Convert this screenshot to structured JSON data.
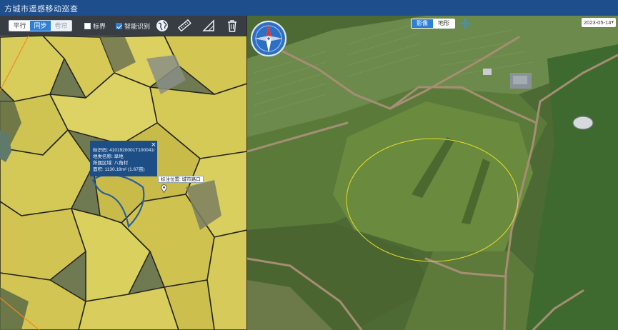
{
  "header": {
    "title": "方城市遥感移动巡查"
  },
  "toolbar": {
    "view_modes": [
      {
        "label": "平行",
        "state": "normal"
      },
      {
        "label": "同步",
        "state": "active"
      },
      {
        "label": "卷帘",
        "state": "disabled"
      }
    ],
    "checkboxes": [
      {
        "label": "标界",
        "checked": false
      },
      {
        "label": "智能识别",
        "checked": true
      }
    ],
    "tools": [
      "globe-icon",
      "ruler-icon",
      "triangle-ruler-icon",
      "trash-icon"
    ]
  },
  "popup": {
    "lines": [
      "标识码: 4101920001T1000416",
      "地类名称: 旱地",
      "所属区域: 八角村",
      "面积: 1130.18m² (1.67亩)"
    ],
    "close": "×"
  },
  "map_label": "标注位置: 城市路口",
  "right_panel": {
    "view_toggle": [
      {
        "label": "影像",
        "active": true
      },
      {
        "label": "地形",
        "active": false
      }
    ],
    "date": "2023-05-14",
    "date_caret": "▾"
  },
  "colors": {
    "header": "#1f4e8c",
    "toolbar": "#323742",
    "accent": "#2f7fd6",
    "parcel_fill": "#d8cd5a",
    "parcel_border": "#2a2a1e",
    "highlight_outline": "#2b5e9e",
    "circle_outline": "#e6dc2a"
  }
}
